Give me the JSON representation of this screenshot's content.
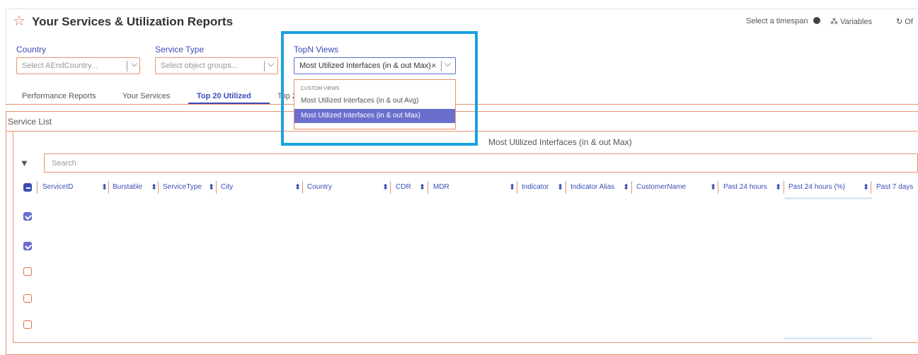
{
  "header": {
    "title": "Your Services & Utilization Reports",
    "actions": [
      {
        "label": "Select a timespan",
        "icon": "clock-icon"
      },
      {
        "label": "Variables",
        "icon": "variables-icon"
      },
      {
        "label": "Of",
        "icon": "refresh-icon"
      }
    ]
  },
  "filters": {
    "country": {
      "label": "Country",
      "placeholder": "Select AEndCountry..."
    },
    "service_type": {
      "label": "Service Type",
      "placeholder": "Select object groups..."
    },
    "topn": {
      "label": "TopN Views",
      "value": "Most Utilized Interfaces (in & out Max)"
    }
  },
  "dropdown": {
    "category": "CUSTOM VIEWS",
    "options": [
      {
        "label": "Most Utilized Interfaces (in & out Avg)",
        "selected": false
      },
      {
        "label": "Most Utilized Interfaces (in & out Max)",
        "selected": true
      }
    ]
  },
  "tabs": [
    {
      "label": "Performance Reports",
      "active": false
    },
    {
      "label": "Your Services",
      "active": false
    },
    {
      "label": "Top 20 Utilized",
      "active": true
    },
    {
      "label": "Top 2",
      "active": false
    }
  ],
  "service_list": {
    "title": "Service List",
    "table_title": "Most Utilized Interfaces (in & out Max)",
    "search_placeholder": "Search",
    "columns": [
      "ServiceID",
      "Burstable",
      "ServiceType",
      "City",
      "Country",
      "CDR",
      "MDR",
      "Indicator",
      "Indicator Alias",
      "CustomerName",
      "Past 24 hours",
      "Past 24 hours (%)",
      "Past 7 days"
    ],
    "row_checks": [
      true,
      true,
      false,
      false,
      false
    ]
  },
  "colors": {
    "accent": "#3a4db5",
    "border": "#e8926f",
    "highlight": "#1aa1e0",
    "selected": "#6a6fce"
  }
}
